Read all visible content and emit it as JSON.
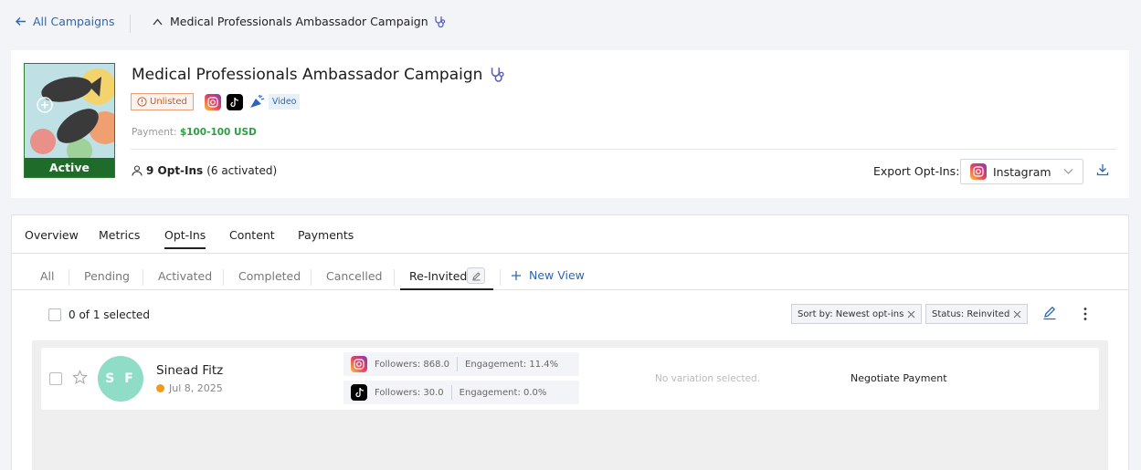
{
  "breadcrumb": {
    "back_label": "All Campaigns",
    "current_label": "Medical Professionals Ambassador Campaign"
  },
  "campaign": {
    "title": "Medical Professionals Ambassador Campaign",
    "status": "Active",
    "visibility_badge": "Unlisted",
    "platforms": [
      "instagram-icon",
      "tiktok-icon",
      "ugc-icon"
    ],
    "content_type_badge": "Video",
    "payment_label": "Payment:",
    "payment_value": "$100-100 USD",
    "optins_count": "9 Opt-Ins",
    "optins_activated": "(6 activated)",
    "export_label": "Export Opt-Ins:",
    "export_selected": "Instagram"
  },
  "tabs": [
    {
      "label": "Overview",
      "active": false
    },
    {
      "label": "Metrics",
      "active": false
    },
    {
      "label": "Opt-Ins",
      "active": true
    },
    {
      "label": "Content",
      "active": false
    },
    {
      "label": "Payments",
      "active": false
    }
  ],
  "subtabs": [
    {
      "label": "All",
      "active": false
    },
    {
      "label": "Pending",
      "active": false
    },
    {
      "label": "Activated",
      "active": false
    },
    {
      "label": "Completed",
      "active": false
    },
    {
      "label": "Cancelled",
      "active": false
    },
    {
      "label": "Re-Invited",
      "active": true
    }
  ],
  "new_view_label": "New View",
  "toolbar": {
    "selection_label": "0 of 1 selected",
    "sort_chip": "Sort by: Newest opt-ins",
    "status_chip": "Status: Reinvited"
  },
  "rows": [
    {
      "initials": "S F",
      "name": "Sinead Fitz",
      "date": "Jul 8, 2025",
      "instagram_followers": "Followers: 868.0",
      "instagram_engagement": "Engagement: 11.4%",
      "tiktok_followers": "Followers: 30.0",
      "tiktok_engagement": "Engagement: 0.0%",
      "variation": "No variation selected.",
      "action": "Negotiate Payment"
    }
  ],
  "colors": {
    "accent": "#2b67b8",
    "active_status": "#1e6b2a",
    "payment_green": "#2e9d45",
    "unlisted_orange": "#c65a20",
    "avatar": "#8fdcc7",
    "date_dot": "#f39a1e"
  }
}
